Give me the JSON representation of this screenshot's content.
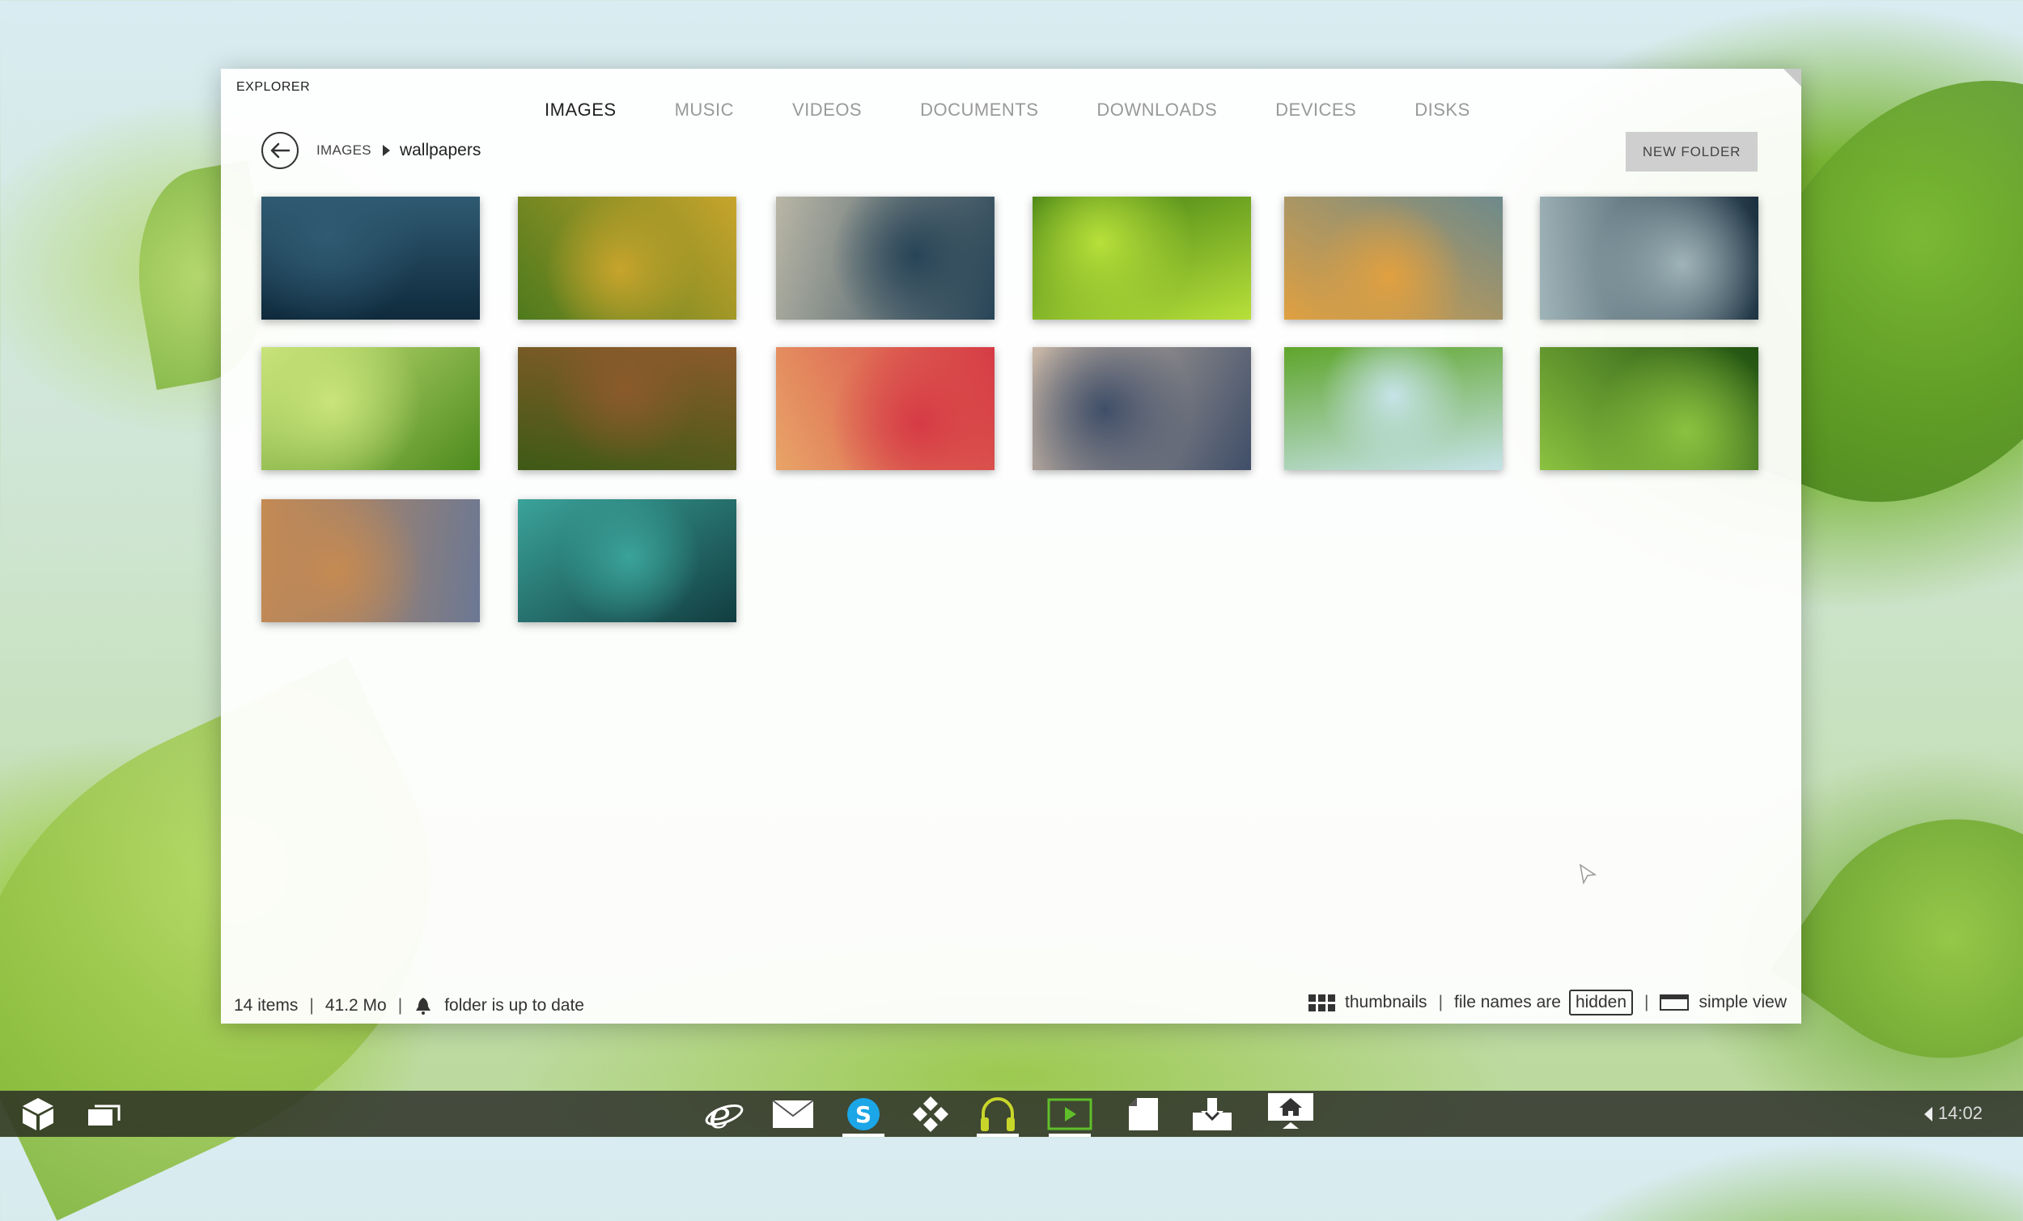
{
  "window": {
    "title": "EXPLORER",
    "tabs": [
      {
        "label": "IMAGES",
        "active": true
      },
      {
        "label": "MUSIC",
        "active": false
      },
      {
        "label": "VIDEOS",
        "active": false
      },
      {
        "label": "DOCUMENTS",
        "active": false
      },
      {
        "label": "DOWNLOADS",
        "active": false
      },
      {
        "label": "DEVICES",
        "active": false
      },
      {
        "label": "DISKS",
        "active": false
      }
    ],
    "breadcrumb": {
      "root": "IMAGES",
      "current": "wallpapers"
    },
    "new_folder_label": "NEW FOLDER"
  },
  "thumbnails": [
    {
      "subject": "ocean water",
      "colors": [
        "#0f2a3c",
        "#2f5a72"
      ]
    },
    {
      "subject": "green and yellow leaves",
      "colors": [
        "#4e7a1d",
        "#c7a42c"
      ]
    },
    {
      "subject": "sea wave",
      "colors": [
        "#b9b6a6",
        "#274457"
      ]
    },
    {
      "subject": "bright green leaves",
      "colors": [
        "#3d7b12",
        "#b8e03a"
      ]
    },
    {
      "subject": "autumn leaf on wall",
      "colors": [
        "#6d8a8c",
        "#e0a040"
      ]
    },
    {
      "subject": "grass at sunset",
      "colors": [
        "#1a2f3f",
        "#9fb4b8"
      ]
    },
    {
      "subject": "green leaves canopy",
      "colors": [
        "#4d8a1e",
        "#c9e47a"
      ]
    },
    {
      "subject": "bamboo forest path",
      "colors": [
        "#3e5a16",
        "#8b5a2b"
      ]
    },
    {
      "subject": "red leaf at beach",
      "colors": [
        "#e8a467",
        "#d63a45"
      ]
    },
    {
      "subject": "sea foam on sand",
      "colors": [
        "#c9b7a6",
        "#3f4e68"
      ]
    },
    {
      "subject": "green leaves branch",
      "colors": [
        "#5fa52b",
        "#c6e3e8"
      ]
    },
    {
      "subject": "maple leaf",
      "colors": [
        "#1f5010",
        "#8cc240"
      ]
    },
    {
      "subject": "dry leaves on stone",
      "colors": [
        "#6b7894",
        "#c58a52"
      ]
    },
    {
      "subject": "water drop on leaf",
      "colors": [
        "#123d40",
        "#3aa39a"
      ]
    }
  ],
  "status": {
    "items": "14 items",
    "size": "41.2 Mo",
    "sync": "folder is up to date",
    "view_mode": "thumbnails",
    "file_names_prefix": "file names are",
    "file_names_state": "hidden",
    "layout": "simple view"
  },
  "taskbar": {
    "clock": "14:02",
    "apps": [
      "internet-explorer",
      "mail",
      "skype",
      "games",
      "music",
      "videos",
      "documents",
      "downloads",
      "home"
    ]
  }
}
